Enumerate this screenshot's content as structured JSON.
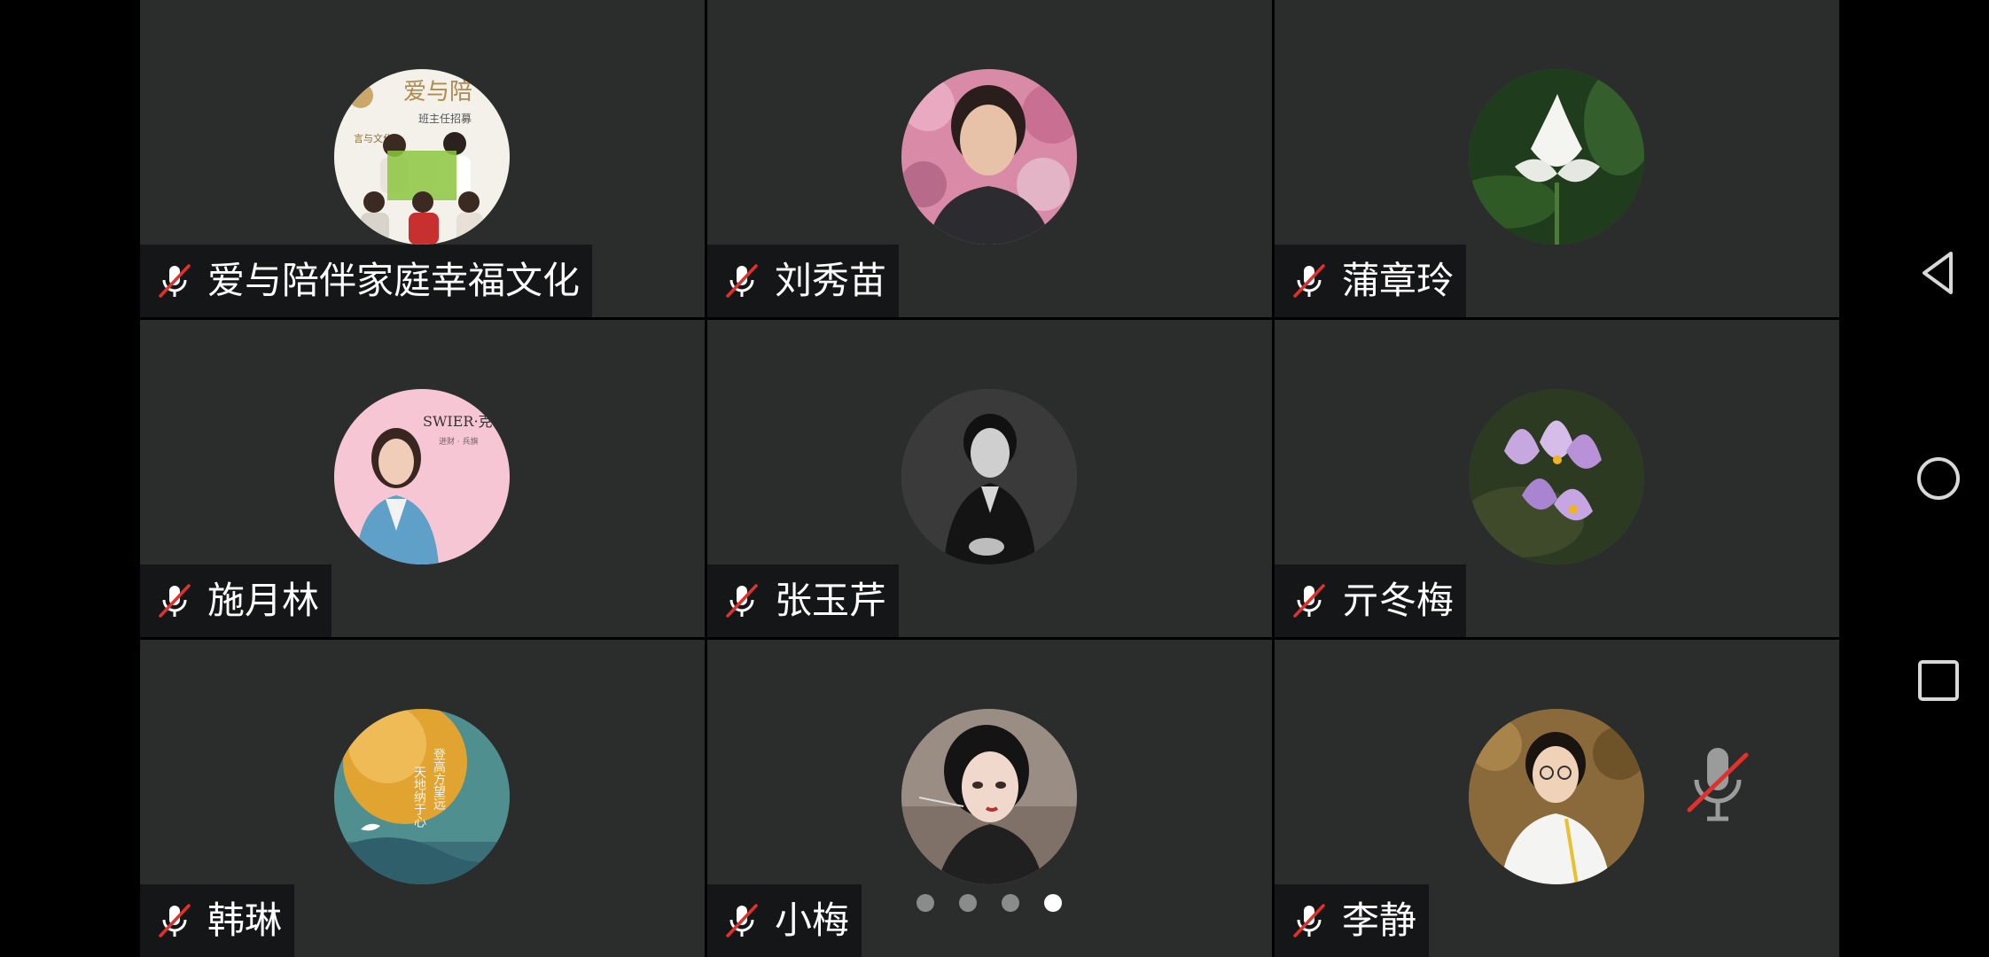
{
  "participants": [
    {
      "name": "爱与陪伴家庭幸福文化",
      "avatar_text": [
        "爱与陪",
        "班主任招募",
        "言与文化"
      ],
      "muted": true
    },
    {
      "name": "刘秀苗",
      "muted": true
    },
    {
      "name": "蒲章玲",
      "muted": true
    },
    {
      "name": "施月林",
      "avatar_text": [
        "SWIER·克",
        "进财 · 兵旗"
      ],
      "muted": true
    },
    {
      "name": "张玉芹",
      "muted": true
    },
    {
      "name": "亓冬梅",
      "muted": true
    },
    {
      "name": "韩琳",
      "avatar_text": [
        "登高方望远",
        "天地纳于心"
      ],
      "muted": true
    },
    {
      "name": "小梅",
      "muted": true
    },
    {
      "name": "李静",
      "muted": true
    }
  ],
  "icons": {
    "muted_mic": "mic-off-icon",
    "back": "back-triangle-icon",
    "home": "home-circle-icon",
    "recents": "recents-square-icon"
  },
  "pagination": {
    "pages": 4,
    "active_index": 3
  },
  "colors": {
    "tile_bg": "#2a2d2c",
    "namebar_bg": "#141617",
    "mute_red": "#e0322c"
  }
}
